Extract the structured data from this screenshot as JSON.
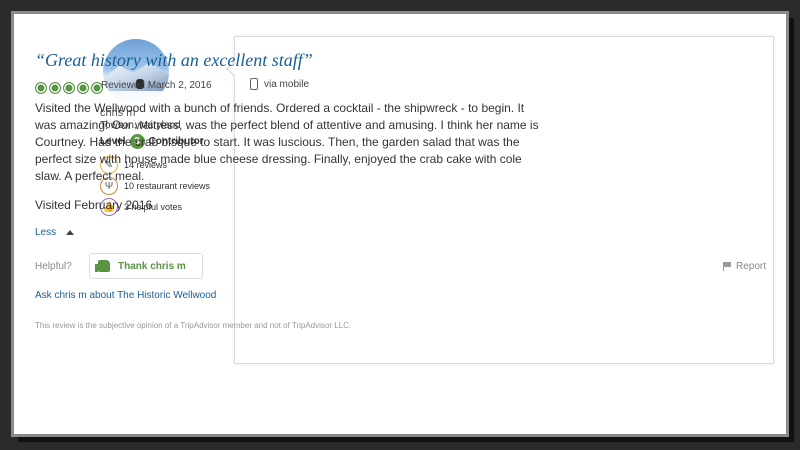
{
  "reviewer": {
    "name": "chris m",
    "location": "Towson, Maryland",
    "level_prefix": "Level",
    "level_number": "3",
    "level_suffix": "Contributor",
    "stats": [
      {
        "icon": "pencil-icon",
        "text": "14 reviews"
      },
      {
        "icon": "restaurant-icon",
        "text": "10 restaurant reviews"
      },
      {
        "icon": "thumbs-up-icon",
        "text": "3 helpful votes"
      }
    ]
  },
  "review": {
    "title": "“Great history with an excellent staff”",
    "rating": 5,
    "reviewed_date": "Reviewed March 2, 2016",
    "via": "via mobile",
    "body": "Visited the Wellwood with a bunch of friends. Ordered a cocktail - the shipwreck - to begin. It was amazing! Our waitress, was the perfect blend of attentive and amusing. I think her name is Courtney. Had the crab bisque to start. It was luscious. Then, the garden salad that was the perfect size with house made blue cheese dressing. Finally, enjoyed the crab cake with cole slaw. A perfect meal.",
    "visited": "Visited February 2016",
    "less_label": "Less",
    "helpful_label": "Helpful?",
    "thank_label": "Thank chris m",
    "report_label": "Report",
    "ask_label": "Ask chris m about The Historic Wellwood",
    "disclaimer": "This review is the subjective opinion of a TripAdvisor member and not of TripAdvisor LLC."
  },
  "colors": {
    "accent_green": "#589442",
    "link_blue": "#1a5e97"
  }
}
